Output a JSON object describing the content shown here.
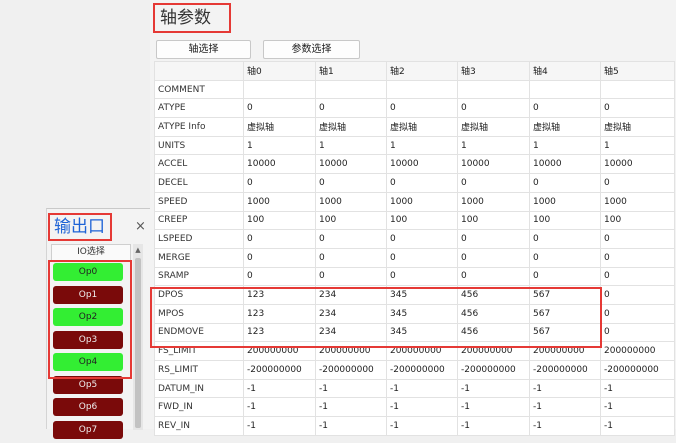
{
  "axis_panel": {
    "title": "轴参数",
    "tab_axis_select": "轴选择",
    "tab_param_select": "参数选择",
    "columns": [
      "",
      "轴0",
      "轴1",
      "轴2",
      "轴3",
      "轴4",
      "轴5"
    ],
    "rows": [
      {
        "label": "COMMENT",
        "values": [
          "",
          "",
          "",
          "",
          "",
          ""
        ]
      },
      {
        "label": "ATYPE",
        "values": [
          "0",
          "0",
          "0",
          "0",
          "0",
          "0"
        ]
      },
      {
        "label": "ATYPE Info",
        "values": [
          "虚拟轴",
          "虚拟轴",
          "虚拟轴",
          "虚拟轴",
          "虚拟轴",
          "虚拟轴"
        ]
      },
      {
        "label": "UNITS",
        "values": [
          "1",
          "1",
          "1",
          "1",
          "1",
          "1"
        ]
      },
      {
        "label": "ACCEL",
        "values": [
          "10000",
          "10000",
          "10000",
          "10000",
          "10000",
          "10000"
        ]
      },
      {
        "label": "DECEL",
        "values": [
          "0",
          "0",
          "0",
          "0",
          "0",
          "0"
        ]
      },
      {
        "label": "SPEED",
        "values": [
          "1000",
          "1000",
          "1000",
          "1000",
          "1000",
          "1000"
        ]
      },
      {
        "label": "CREEP",
        "values": [
          "100",
          "100",
          "100",
          "100",
          "100",
          "100"
        ]
      },
      {
        "label": "LSPEED",
        "values": [
          "0",
          "0",
          "0",
          "0",
          "0",
          "0"
        ]
      },
      {
        "label": "MERGE",
        "values": [
          "0",
          "0",
          "0",
          "0",
          "0",
          "0"
        ]
      },
      {
        "label": "SRAMP",
        "values": [
          "0",
          "0",
          "0",
          "0",
          "0",
          "0"
        ]
      },
      {
        "label": "DPOS",
        "values": [
          "123",
          "234",
          "345",
          "456",
          "567",
          "0"
        ]
      },
      {
        "label": "MPOS",
        "values": [
          "123",
          "234",
          "345",
          "456",
          "567",
          "0"
        ]
      },
      {
        "label": "ENDMOVE",
        "values": [
          "123",
          "234",
          "345",
          "456",
          "567",
          "0"
        ]
      },
      {
        "label": "FS_LIMIT",
        "values": [
          "200000000",
          "200000000",
          "200000000",
          "200000000",
          "200000000",
          "200000000"
        ]
      },
      {
        "label": "RS_LIMIT",
        "values": [
          "-200000000",
          "-200000000",
          "-200000000",
          "-200000000",
          "-200000000",
          "-200000000"
        ]
      },
      {
        "label": "DATUM_IN",
        "values": [
          "-1",
          "-1",
          "-1",
          "-1",
          "-1",
          "-1"
        ]
      },
      {
        "label": "FWD_IN",
        "values": [
          "-1",
          "-1",
          "-1",
          "-1",
          "-1",
          "-1"
        ]
      },
      {
        "label": "REV_IN",
        "values": [
          "-1",
          "-1",
          "-1",
          "-1",
          "-1",
          "-1"
        ]
      }
    ]
  },
  "output_panel": {
    "title": "输出口",
    "close_glyph": "×",
    "io_select_label": "IO选择",
    "outputs": [
      {
        "label": "Op0",
        "state": "on"
      },
      {
        "label": "Op1",
        "state": "off"
      },
      {
        "label": "Op2",
        "state": "on"
      },
      {
        "label": "Op3",
        "state": "off"
      },
      {
        "label": "Op4",
        "state": "on"
      },
      {
        "label": "Op5",
        "state": "off"
      },
      {
        "label": "Op6",
        "state": "off"
      },
      {
        "label": "Op7",
        "state": "off"
      }
    ],
    "colors": {
      "on": "#33ee33",
      "off": "#7a0a0a"
    }
  },
  "highlight_color": "#e53935"
}
